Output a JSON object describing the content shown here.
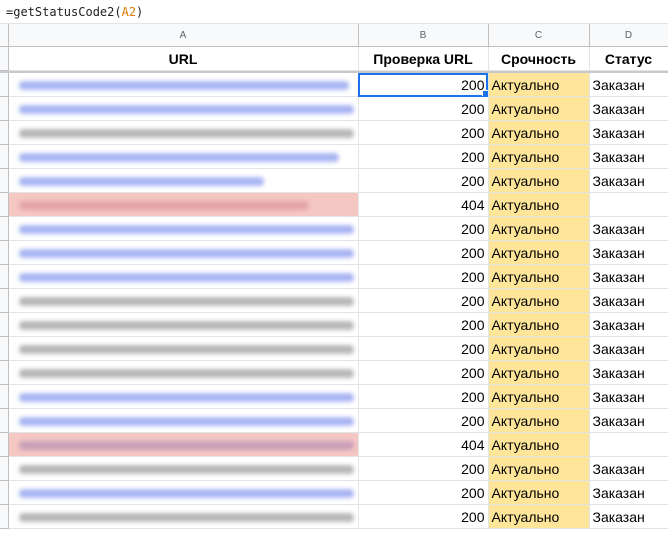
{
  "formula": {
    "prefix": "=getStatusCode2(",
    "ref": "A2",
    "suffix": ")"
  },
  "columns": [
    "A",
    "B",
    "C",
    "D"
  ],
  "headers": [
    "URL",
    "Проверка URL",
    "Срочность",
    "Статус"
  ],
  "rows": [
    {
      "code": "200",
      "urgency": "Актуально",
      "status": "Заказан"
    },
    {
      "code": "200",
      "urgency": "Актуально",
      "status": "Заказан"
    },
    {
      "code": "200",
      "urgency": "Актуально",
      "status": "Заказан"
    },
    {
      "code": "200",
      "urgency": "Актуально",
      "status": "Заказан"
    },
    {
      "code": "200",
      "urgency": "Актуально",
      "status": "Заказан"
    },
    {
      "code": "404",
      "urgency": "Актуально",
      "status": ""
    },
    {
      "code": "200",
      "urgency": "Актуально",
      "status": "Заказан"
    },
    {
      "code": "200",
      "urgency": "Актуально",
      "status": "Заказан"
    },
    {
      "code": "200",
      "urgency": "Актуально",
      "status": "Заказан"
    },
    {
      "code": "200",
      "urgency": "Актуально",
      "status": "Заказан"
    },
    {
      "code": "200",
      "urgency": "Актуально",
      "status": "Заказан"
    },
    {
      "code": "200",
      "urgency": "Актуально",
      "status": "Заказан"
    },
    {
      "code": "200",
      "urgency": "Актуально",
      "status": "Заказан"
    },
    {
      "code": "200",
      "urgency": "Актуально",
      "status": "Заказан"
    },
    {
      "code": "200",
      "urgency": "Актуально",
      "status": "Заказан"
    },
    {
      "code": "404",
      "urgency": "Актуально",
      "status": ""
    },
    {
      "code": "200",
      "urgency": "Актуально",
      "status": "Заказан"
    },
    {
      "code": "200",
      "urgency": "Актуально",
      "status": "Заказан"
    },
    {
      "code": "200",
      "urgency": "Актуально",
      "status": "Заказан"
    }
  ],
  "colors": {
    "urgency_fill": "#ffe599",
    "error_row_fill": "#f4c7c3",
    "selection": "#1a73e8"
  }
}
